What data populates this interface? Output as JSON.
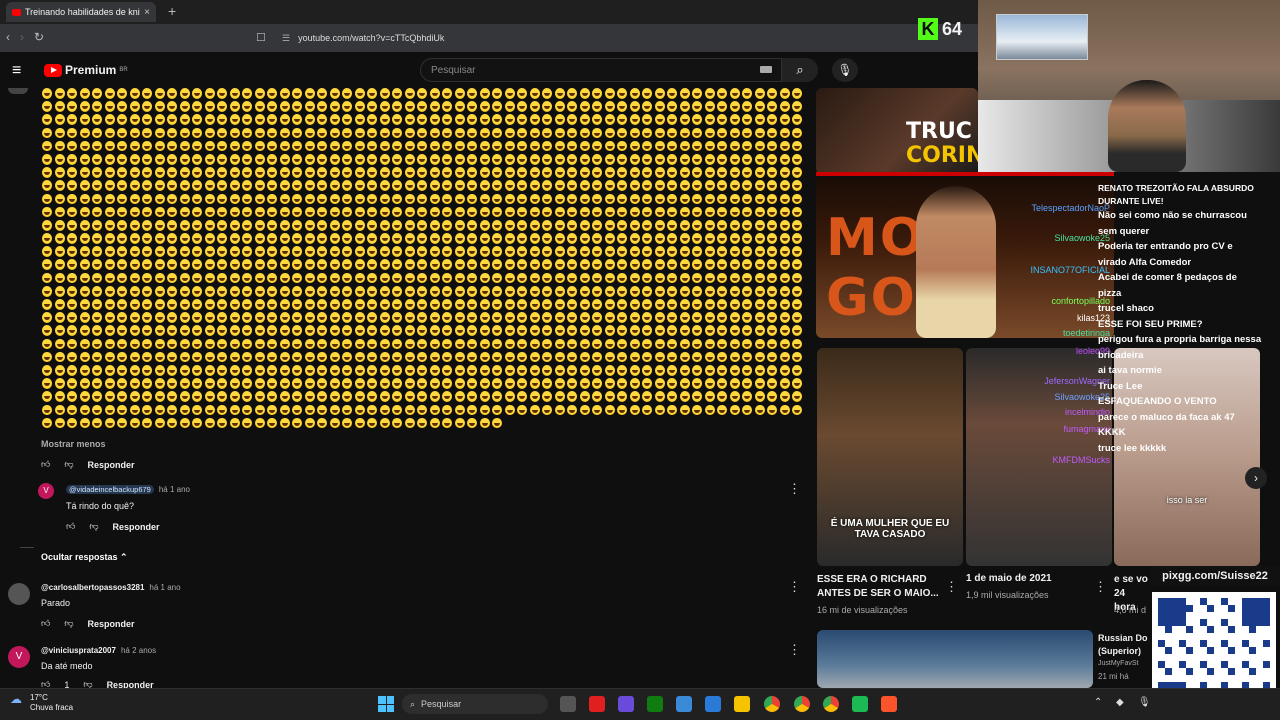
{
  "browser": {
    "tab_title": "Treinando habilidades de knife",
    "tab_close": "×",
    "new_tab": "+",
    "url": "youtube.com/watch?v=cTTcQbhdiUk"
  },
  "youtube": {
    "logo_text": "Premium",
    "logo_region": "BR",
    "search_placeholder": "Pesquisar"
  },
  "comments": {
    "show_less": "Mostrar menos",
    "reply_label": "Responder",
    "hide_replies": "Ocultar respostas",
    "items": [
      {
        "handle": "@vidadeincelbackup679",
        "time": "há 1 ano",
        "text": "Tá rindo do quê?",
        "avatar": "V",
        "avatar_color": "#c2185b"
      },
      {
        "handle": "@carlosalbertopassos3281",
        "time": "há 1 ano",
        "text": "Parado",
        "avatar": "",
        "avatar_color": "#555555"
      },
      {
        "handle": "@viniciusprata2007",
        "time": "há 2 anos",
        "text": "Da até medo",
        "avatar": "V",
        "avatar_color": "#c2185b"
      }
    ],
    "like_count_partial": "1"
  },
  "thumb_top": {
    "text1": "TRUC",
    "text2": "CORIN"
  },
  "thumb_mid": {
    "text": "MON GOL!"
  },
  "videos": [
    {
      "caption": "É UMA MULHER QUE EU TAVA CASADO",
      "title": "ESSE ERA O RICHARD ANTES DE SER O MAIO...",
      "meta": "16 mi de visualizações"
    },
    {
      "caption": "",
      "title": "1 de maio de 2021",
      "meta": "1,9 mil visualizações"
    },
    {
      "caption": "isso ia ser",
      "title": "e se vo 24 hora",
      "meta": "4,6 mi d"
    }
  ],
  "video_bottom": {
    "title": "Russian Do (Superior)",
    "channel": "JustMyFavSt",
    "meta": "21 mi há"
  },
  "chat": {
    "names": [
      "TelespectadorNaoP",
      "Silvaowoke25",
      "INSANO77OFICIAL",
      "confortopillado",
      "kilas123",
      "toedetiringa",
      "leoleo99",
      "JefersonWagner",
      "Silvaowoke25",
      "incelmindio",
      "fumagmaxx",
      "KMFDMSucks"
    ],
    "messages": [
      "RENATO TREZOITÃO FALA ABSURDO DURANTE LIVE!",
      "Não sei como não se churrascou sem querer",
      "Poderia ter entrando pro CV e virado Alfa Comedor",
      "Acabei de comer 8 pedaços de pizza",
      "trucel shaco",
      "ESSE FOI SEU PRIME?",
      "perigou fura a propria barriga nessa bricadeira",
      "ai tava normie",
      "Truce Lee",
      "ESFAQUEANDO O VENTO",
      "parece o maluco da faca ak 47 KKKK",
      "truce lee kkkkk"
    ]
  },
  "overlay": {
    "kick_viewers": "64",
    "pix": "pixgg.com/Suisse22"
  },
  "taskbar": {
    "weather_temp": "17°C",
    "weather_desc": "Chuva fraca",
    "search_placeholder": "Pesquisar"
  }
}
